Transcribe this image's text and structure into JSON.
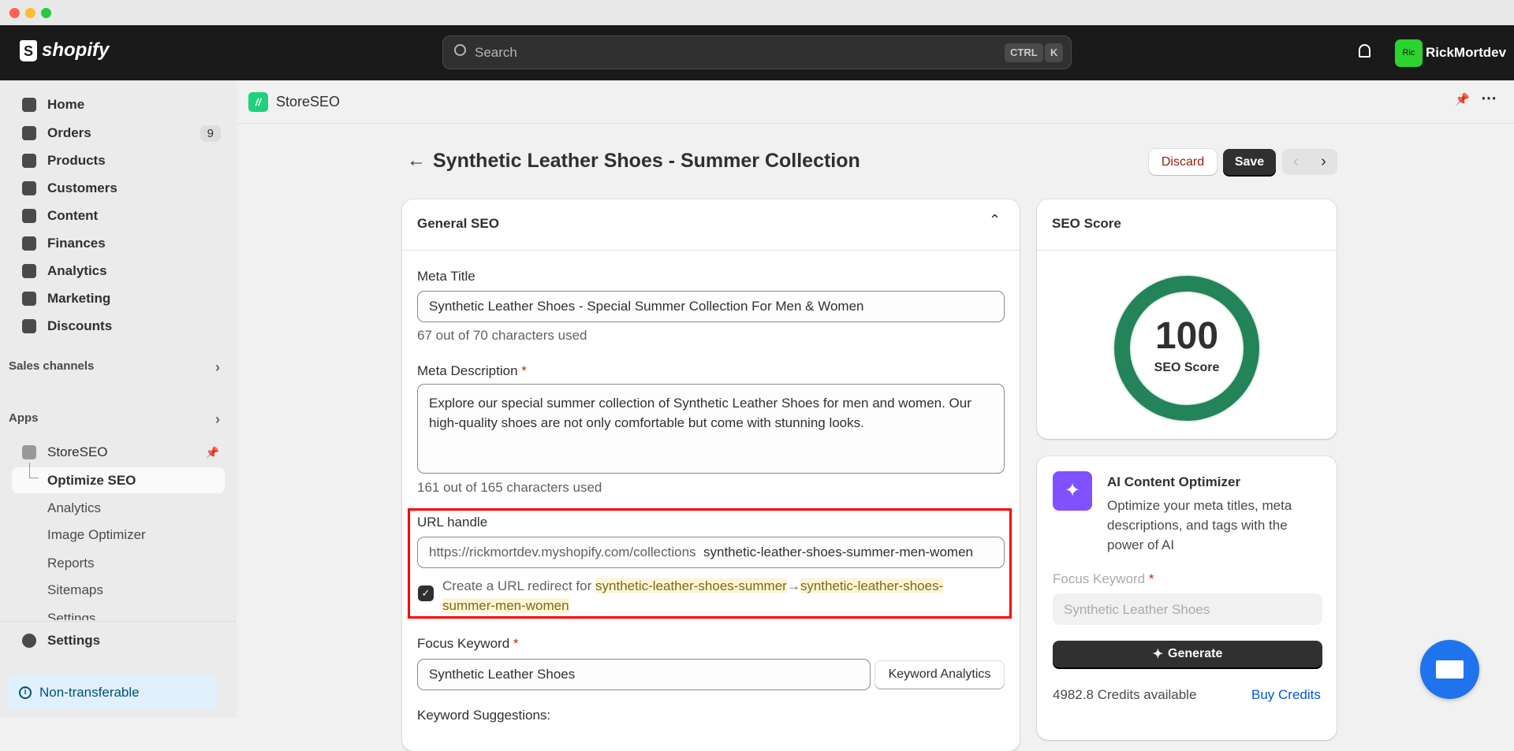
{
  "window": {
    "colors": {
      "close": "#ff5f57",
      "minimize": "#febc2e",
      "maximize": "#28c840"
    }
  },
  "topbar": {
    "logo": "shopify",
    "search_placeholder": "Search",
    "shortcut": [
      "CTRL",
      "K"
    ],
    "user_initials": "Ric",
    "user_name": "RickMortdev",
    "avatar_color": "#2dd32d"
  },
  "sidebar": {
    "items": [
      {
        "label": "Home"
      },
      {
        "label": "Orders",
        "badge": "9"
      },
      {
        "label": "Products"
      },
      {
        "label": "Customers"
      },
      {
        "label": "Content"
      },
      {
        "label": "Finances"
      },
      {
        "label": "Analytics"
      },
      {
        "label": "Marketing"
      },
      {
        "label": "Discounts"
      }
    ],
    "sales_channels": "Sales channels",
    "apps": "Apps",
    "app_name": "StoreSEO",
    "app_items": [
      "Optimize SEO",
      "Analytics",
      "Image Optimizer",
      "Reports",
      "Sitemaps",
      "Settings"
    ],
    "settings": "Settings",
    "non_transferable": "Non-transferable"
  },
  "app_header": {
    "title": "StoreSEO"
  },
  "page": {
    "title": "Synthetic Leather Shoes - Summer Collection",
    "discard": "Discard",
    "save": "Save"
  },
  "general_seo": {
    "title": "General SEO",
    "meta_title_label": "Meta Title",
    "meta_title": "Synthetic Leather Shoes - Special Summer Collection For Men & Women",
    "meta_title_count": "67 out of 70 characters used",
    "meta_desc_label": "Meta Description",
    "meta_desc": "Explore our special summer collection of Synthetic Leather Shoes for men and women. Our high-quality shoes are not only comfortable but come with stunning looks.",
    "meta_desc_count": "161 out of 165 characters used",
    "url_label": "URL handle",
    "url_prefix": "https://rickmortdev.myshopify.com/collections",
    "url_handle": "synthetic-leather-shoes-summer-men-women",
    "redirect_text": "Create a URL redirect for",
    "redirect_from": "synthetic-leather-shoes-summer",
    "redirect_arrow": "→",
    "redirect_to": "synthetic-leather-shoes-summer-men-women",
    "redirect_checked": true,
    "focus_label": "Focus Keyword",
    "focus_value": "Synthetic Leather Shoes",
    "keyword_analytics": "Keyword Analytics",
    "suggestions_label": "Keyword Suggestions:"
  },
  "seo_score": {
    "title": "SEO Score",
    "value": "100",
    "label": "SEO Score",
    "percent": 100,
    "color": "#23845a"
  },
  "ai": {
    "title": "AI Content Optimizer",
    "description": "Optimize your meta titles, meta descriptions, and tags with the power of AI",
    "focus_label": "Focus Keyword",
    "focus_placeholder": "Synthetic Leather Shoes",
    "generate": "Generate",
    "credits": "4982.8 Credits available",
    "buy": "Buy Credits",
    "icon_color": "#8051ff"
  }
}
